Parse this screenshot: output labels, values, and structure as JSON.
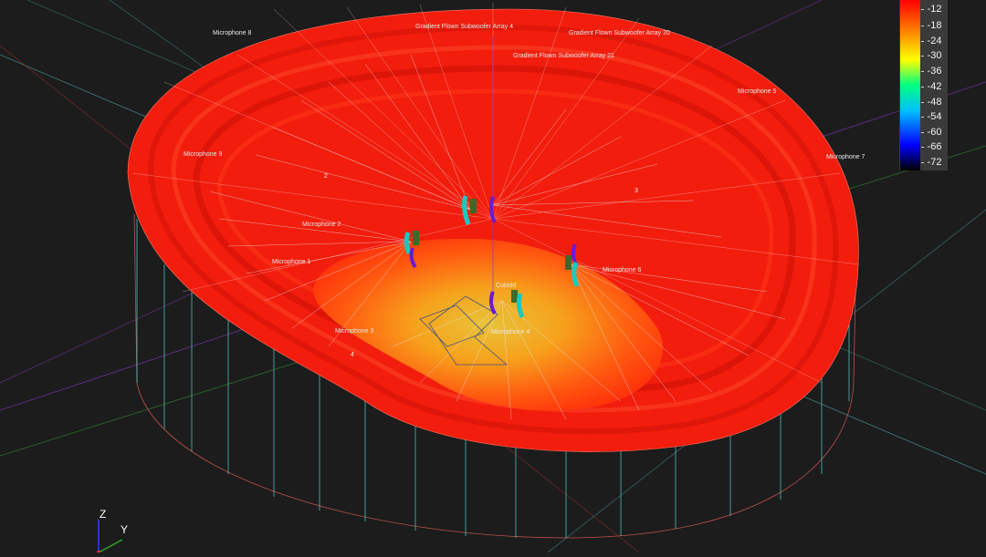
{
  "viewport": {
    "labels": {
      "mic8": "Microphone 8",
      "gfsa4": "Gradient Flown Subwoofer Array 4",
      "gfsa20": "Gradient Flown Subwoofer Array 20",
      "gfsa21": "Gradient Flown Subwoofer Array 21",
      "mic5": "Microphone 5",
      "mic9": "Microphone 9",
      "mic7": "Microphone 7",
      "mic2": "Microphone 2",
      "mic1": "Microphone 1",
      "mic6": "Microphone 6",
      "cubold": "Cubold",
      "mic3": "Microphone 3",
      "mic4": "Microphone 4",
      "n2": "2",
      "n3": "3",
      "n4": "4"
    }
  },
  "legend": {
    "ticks": [
      "-12",
      "-18",
      "-24",
      "-30",
      "-36",
      "-42",
      "-48",
      "-54",
      "-60",
      "-66",
      "-72"
    ],
    "colors": [
      "#ff0000",
      "#ff8000",
      "#ffff00",
      "#00ff80",
      "#00c0ff",
      "#0000ff",
      "#000000"
    ]
  },
  "triad": {
    "z": "Z",
    "y": "Y"
  }
}
